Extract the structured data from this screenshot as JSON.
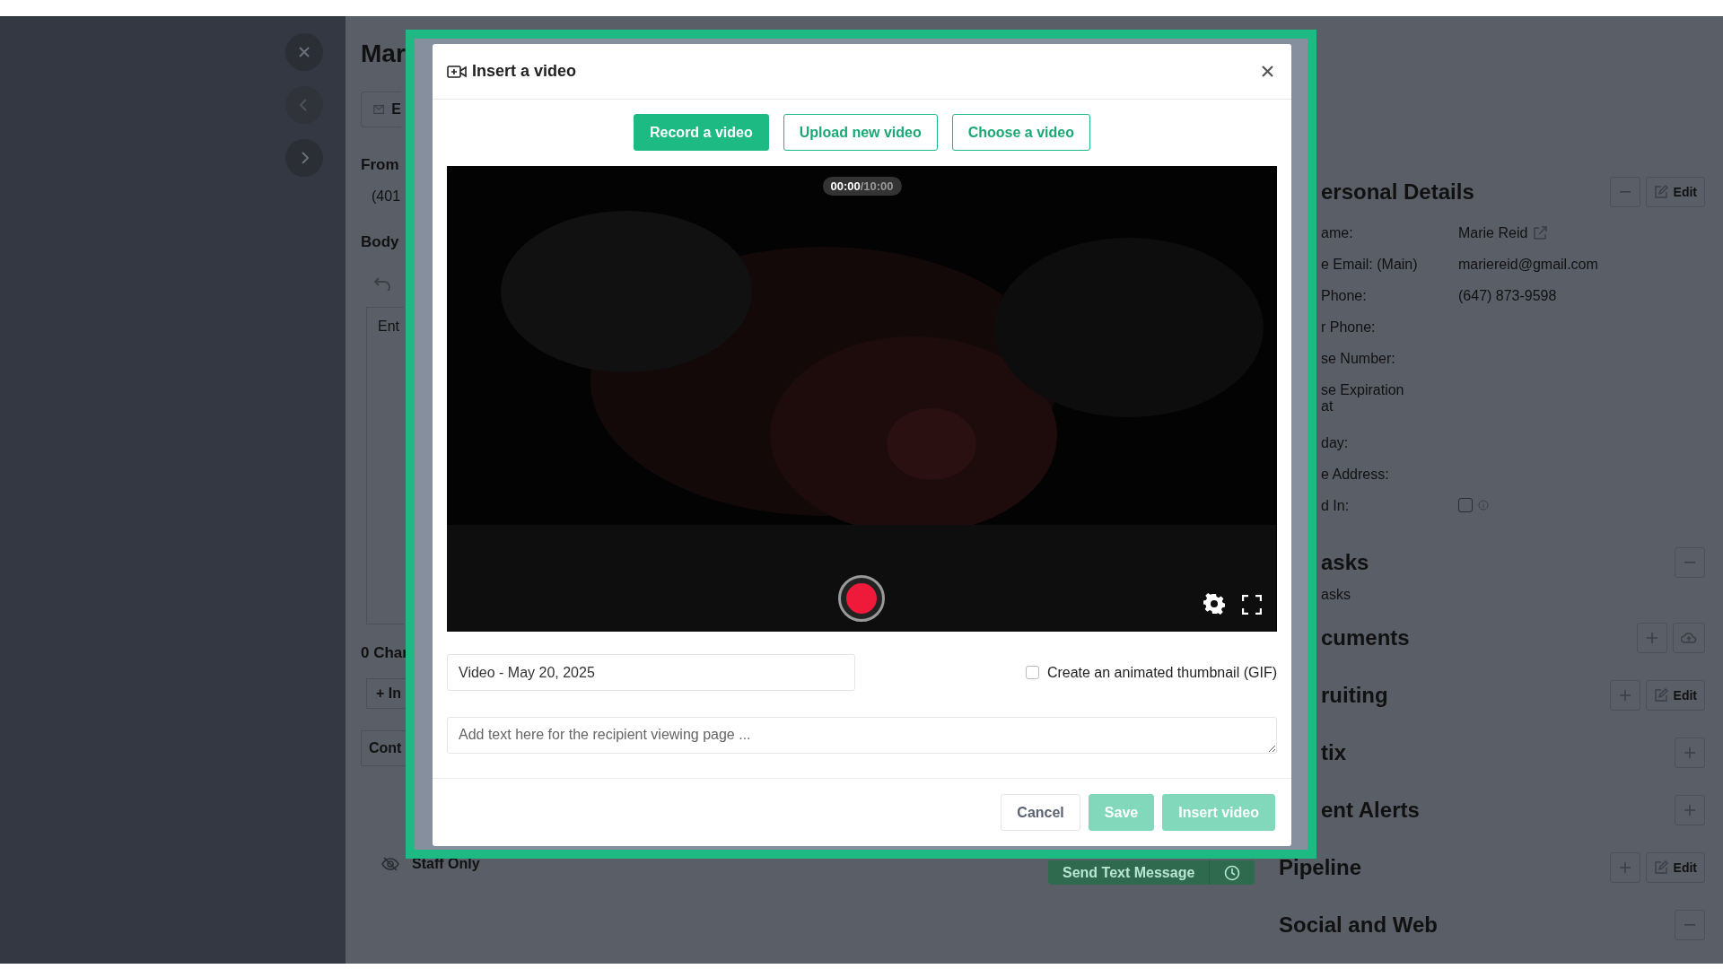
{
  "nav_buttons": [
    {
      "kind": "close",
      "disabled": false
    },
    {
      "kind": "back",
      "disabled": true
    },
    {
      "kind": "forward",
      "disabled": false
    }
  ],
  "compose": {
    "title": "Mar",
    "channel_tab": "E",
    "from_label": "From",
    "from_value": "(401",
    "body_label": "Body",
    "editor_placeholder": "Ent",
    "char_count": "0 Char",
    "insert_button": "+ In",
    "contact_field": "Cont",
    "staff_only": "Staff Only",
    "send_button": "Send Text Message"
  },
  "details": {
    "sections": [
      {
        "title": "ersonal Details",
        "clipped": true,
        "actions": [
          {
            "kind": "collapse"
          },
          {
            "kind": "edit",
            "label": "Edit"
          }
        ],
        "fields": [
          {
            "label": "ame:",
            "value": "Marie Reid",
            "kind": "link"
          },
          {
            "label": "e Email: (Main)",
            "value": "mariereid@gmail.com",
            "kind": "text"
          },
          {
            "label": "Phone:",
            "value": "(647) 873-9598",
            "kind": "text"
          },
          {
            "label": "r Phone:",
            "kind": "text"
          },
          {
            "label": "se Number:",
            "kind": "text"
          },
          {
            "label": "se Expiration at",
            "kind": "text"
          },
          {
            "label": "day:",
            "kind": "text"
          },
          {
            "label": "e Address:",
            "kind": "text"
          },
          {
            "label": "d In:",
            "kind": "checkbox",
            "checked": false
          }
        ]
      },
      {
        "title": "asks",
        "clipped": true,
        "actions": [
          {
            "kind": "collapse"
          }
        ],
        "empty_text": "asks"
      },
      {
        "title": "cuments",
        "clipped": true,
        "actions": [
          {
            "kind": "add"
          },
          {
            "kind": "upload"
          }
        ]
      },
      {
        "title": "ruiting",
        "clipped": true,
        "actions": [
          {
            "kind": "add"
          },
          {
            "kind": "edit",
            "label": "Edit"
          }
        ]
      },
      {
        "title": "tix",
        "clipped": true,
        "actions": [
          {
            "kind": "add"
          }
        ]
      },
      {
        "title": "ent Alerts",
        "clipped": true,
        "actions": [
          {
            "kind": "add"
          }
        ]
      },
      {
        "title": "Pipeline",
        "clipped": false,
        "actions": [
          {
            "kind": "add"
          },
          {
            "kind": "edit",
            "label": "Edit"
          }
        ]
      },
      {
        "title": "Social and Web",
        "clipped": false,
        "actions": [
          {
            "kind": "collapse"
          }
        ]
      }
    ]
  },
  "modal": {
    "title": "Insert a video",
    "tabs": [
      {
        "label": "Record a video",
        "selected": true
      },
      {
        "label": "Upload new video",
        "selected": false
      },
      {
        "label": "Choose a video",
        "selected": false
      }
    ],
    "timer": {
      "elapsed": "00:00",
      "limit": "/10:00"
    },
    "title_field": {
      "value": "Video - May 20, 2025"
    },
    "gif_option": {
      "label": "Create an animated thumbnail (GIF)",
      "checked": false
    },
    "message_field": {
      "placeholder": "Add text here for the recipient viewing page ..."
    },
    "buttons": [
      {
        "label": "Cancel",
        "kind": "secondary",
        "disabled": false
      },
      {
        "label": "Save",
        "kind": "primary",
        "disabled": true
      },
      {
        "label": "Insert video",
        "kind": "primary",
        "disabled": true
      }
    ]
  }
}
